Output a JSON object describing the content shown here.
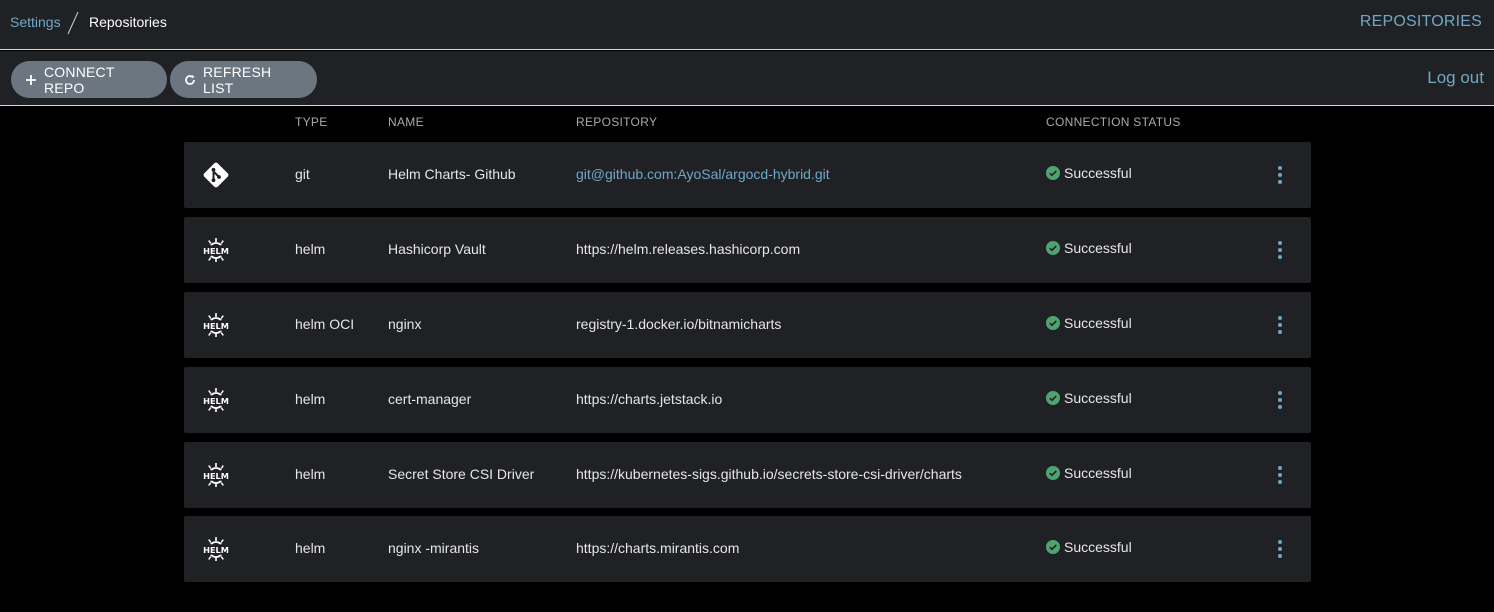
{
  "breadcrumb": {
    "parent": "Settings",
    "current": "Repositories"
  },
  "header": {
    "page_name": "REPOSITORIES"
  },
  "toolbar": {
    "connect_label": "CONNECT REPO",
    "refresh_label": "REFRESH LIST",
    "logout_label": "Log out"
  },
  "columns": {
    "type": "TYPE",
    "name": "NAME",
    "repository": "REPOSITORY",
    "status": "CONNECTION STATUS"
  },
  "colors": {
    "accent": "#6fa8c4",
    "success": "#4ea371",
    "button": "#6b7681",
    "panel": "#202125"
  },
  "rows": [
    {
      "icon": "git-icon",
      "type": "git",
      "name": "Helm Charts- Github",
      "repository": "git@github.com:AyoSal/argocd-hybrid.git",
      "status": "Successful"
    },
    {
      "icon": "helm-icon",
      "type": "helm",
      "name": "Hashicorp Vault",
      "repository": "https://helm.releases.hashicorp.com",
      "status": "Successful"
    },
    {
      "icon": "helm-icon",
      "type": "helm OCI",
      "name": "nginx",
      "repository": "registry-1.docker.io/bitnamicharts",
      "status": "Successful"
    },
    {
      "icon": "helm-icon",
      "type": "helm",
      "name": "cert-manager",
      "repository": "https://charts.jetstack.io",
      "status": "Successful"
    },
    {
      "icon": "helm-icon",
      "type": "helm",
      "name": "Secret Store CSI Driver",
      "repository": "https://kubernetes-sigs.github.io/secrets-store-csi-driver/charts",
      "status": "Successful"
    },
    {
      "icon": "helm-icon",
      "type": "helm",
      "name": "nginx -mirantis",
      "repository": "https://charts.mirantis.com",
      "status": "Successful"
    }
  ]
}
